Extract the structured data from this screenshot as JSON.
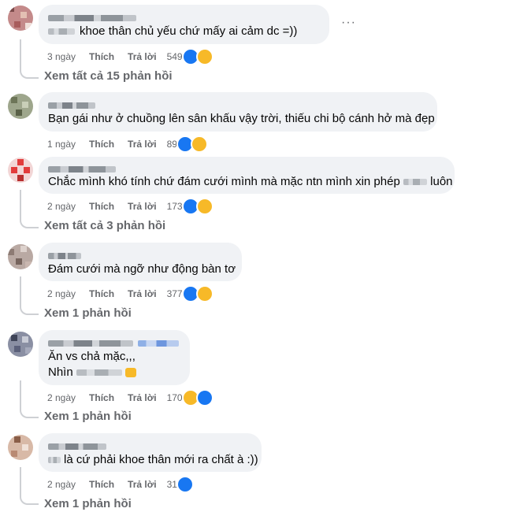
{
  "comments": [
    {
      "text": "khoe thân chủ yếu chứ mấy ai cảm dc   =))",
      "time": "3 ngày",
      "like": "Thích",
      "reply": "Trả lời",
      "reactions": "549",
      "view_replies": "Xem tất cả 15 phản hồi"
    },
    {
      "text": "Bạn gái như ở chuồng lên sân khấu vậy trời, thiếu chi bộ cánh hở mà đẹp",
      "time": "1 ngày",
      "like": "Thích",
      "reply": "Trả lời",
      "reactions": "89"
    },
    {
      "text_before": "Chắc mình khó tính chứ đám cưới mình mà mặc ntn mình xin phép",
      "text_after": "luôn",
      "time": "2 ngày",
      "like": "Thích",
      "reply": "Trả lời",
      "reactions": "173",
      "view_replies": "Xem tất cả 3 phản hồi"
    },
    {
      "text": "Đám cưới mà ngỡ như động bàn tơ",
      "time": "2 ngày",
      "like": "Thích",
      "reply": "Trả lời",
      "reactions": "377",
      "view_replies": "Xem 1 phản hồi"
    },
    {
      "line1": "Ăn vs chả mặc,,,",
      "line2": "Nhìn",
      "time": "2 ngày",
      "like": "Thích",
      "reply": "Trả lời",
      "reactions": "170",
      "view_replies": "Xem 1 phản hồi"
    },
    {
      "text": "là cứ phải khoe thân mới ra chất à :))",
      "time": "2 ngày",
      "like": "Thích",
      "reply": "Trả lời",
      "reactions": "31",
      "view_replies": "Xem 1 phản hồi"
    }
  ],
  "more_options": "···",
  "icons": [
    "like-reaction-icon",
    "haha-reaction-icon"
  ],
  "colors": {
    "bubble": "#f0f2f5",
    "meta": "#65676b",
    "like_blue": "#1877f2",
    "haha_yellow": "#f7b928"
  }
}
